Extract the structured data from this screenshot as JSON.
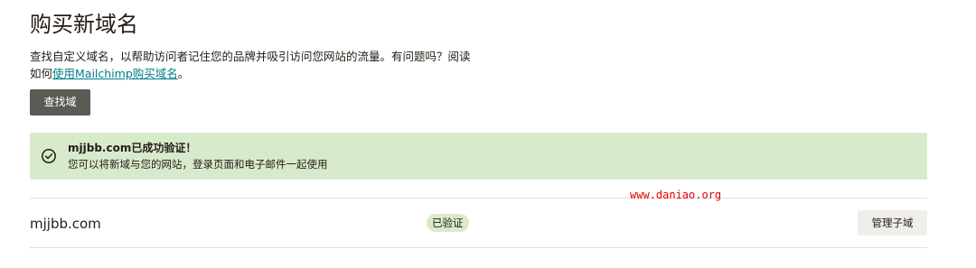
{
  "page": {
    "title": "购买新域名",
    "description_line1": "查找自定义域名，以帮助访问者记住您的品牌并吸引访问您网站的流量。有问题吗？阅读",
    "description_line2_prefix": "如何",
    "description_link": "使用Mailchimp购买域名",
    "description_line2_suffix": "。",
    "find_button_label": "查找域"
  },
  "banner": {
    "icon": "check-circle-icon",
    "title": "mjjbb.com已成功验证！",
    "subtitle": "您可以将新域与您的网站，登录页面和电子邮件一起使用",
    "background_color": "#d8eacc"
  },
  "watermark": "www.daniao.org",
  "domains": [
    {
      "name": "mjjbb.com",
      "status": "已验证",
      "action_label": "管理子域"
    }
  ],
  "colors": {
    "link": "#007c89",
    "primary_button": "#5c5a55",
    "secondary_button": "#efeeea",
    "watermark": "#e00000"
  }
}
